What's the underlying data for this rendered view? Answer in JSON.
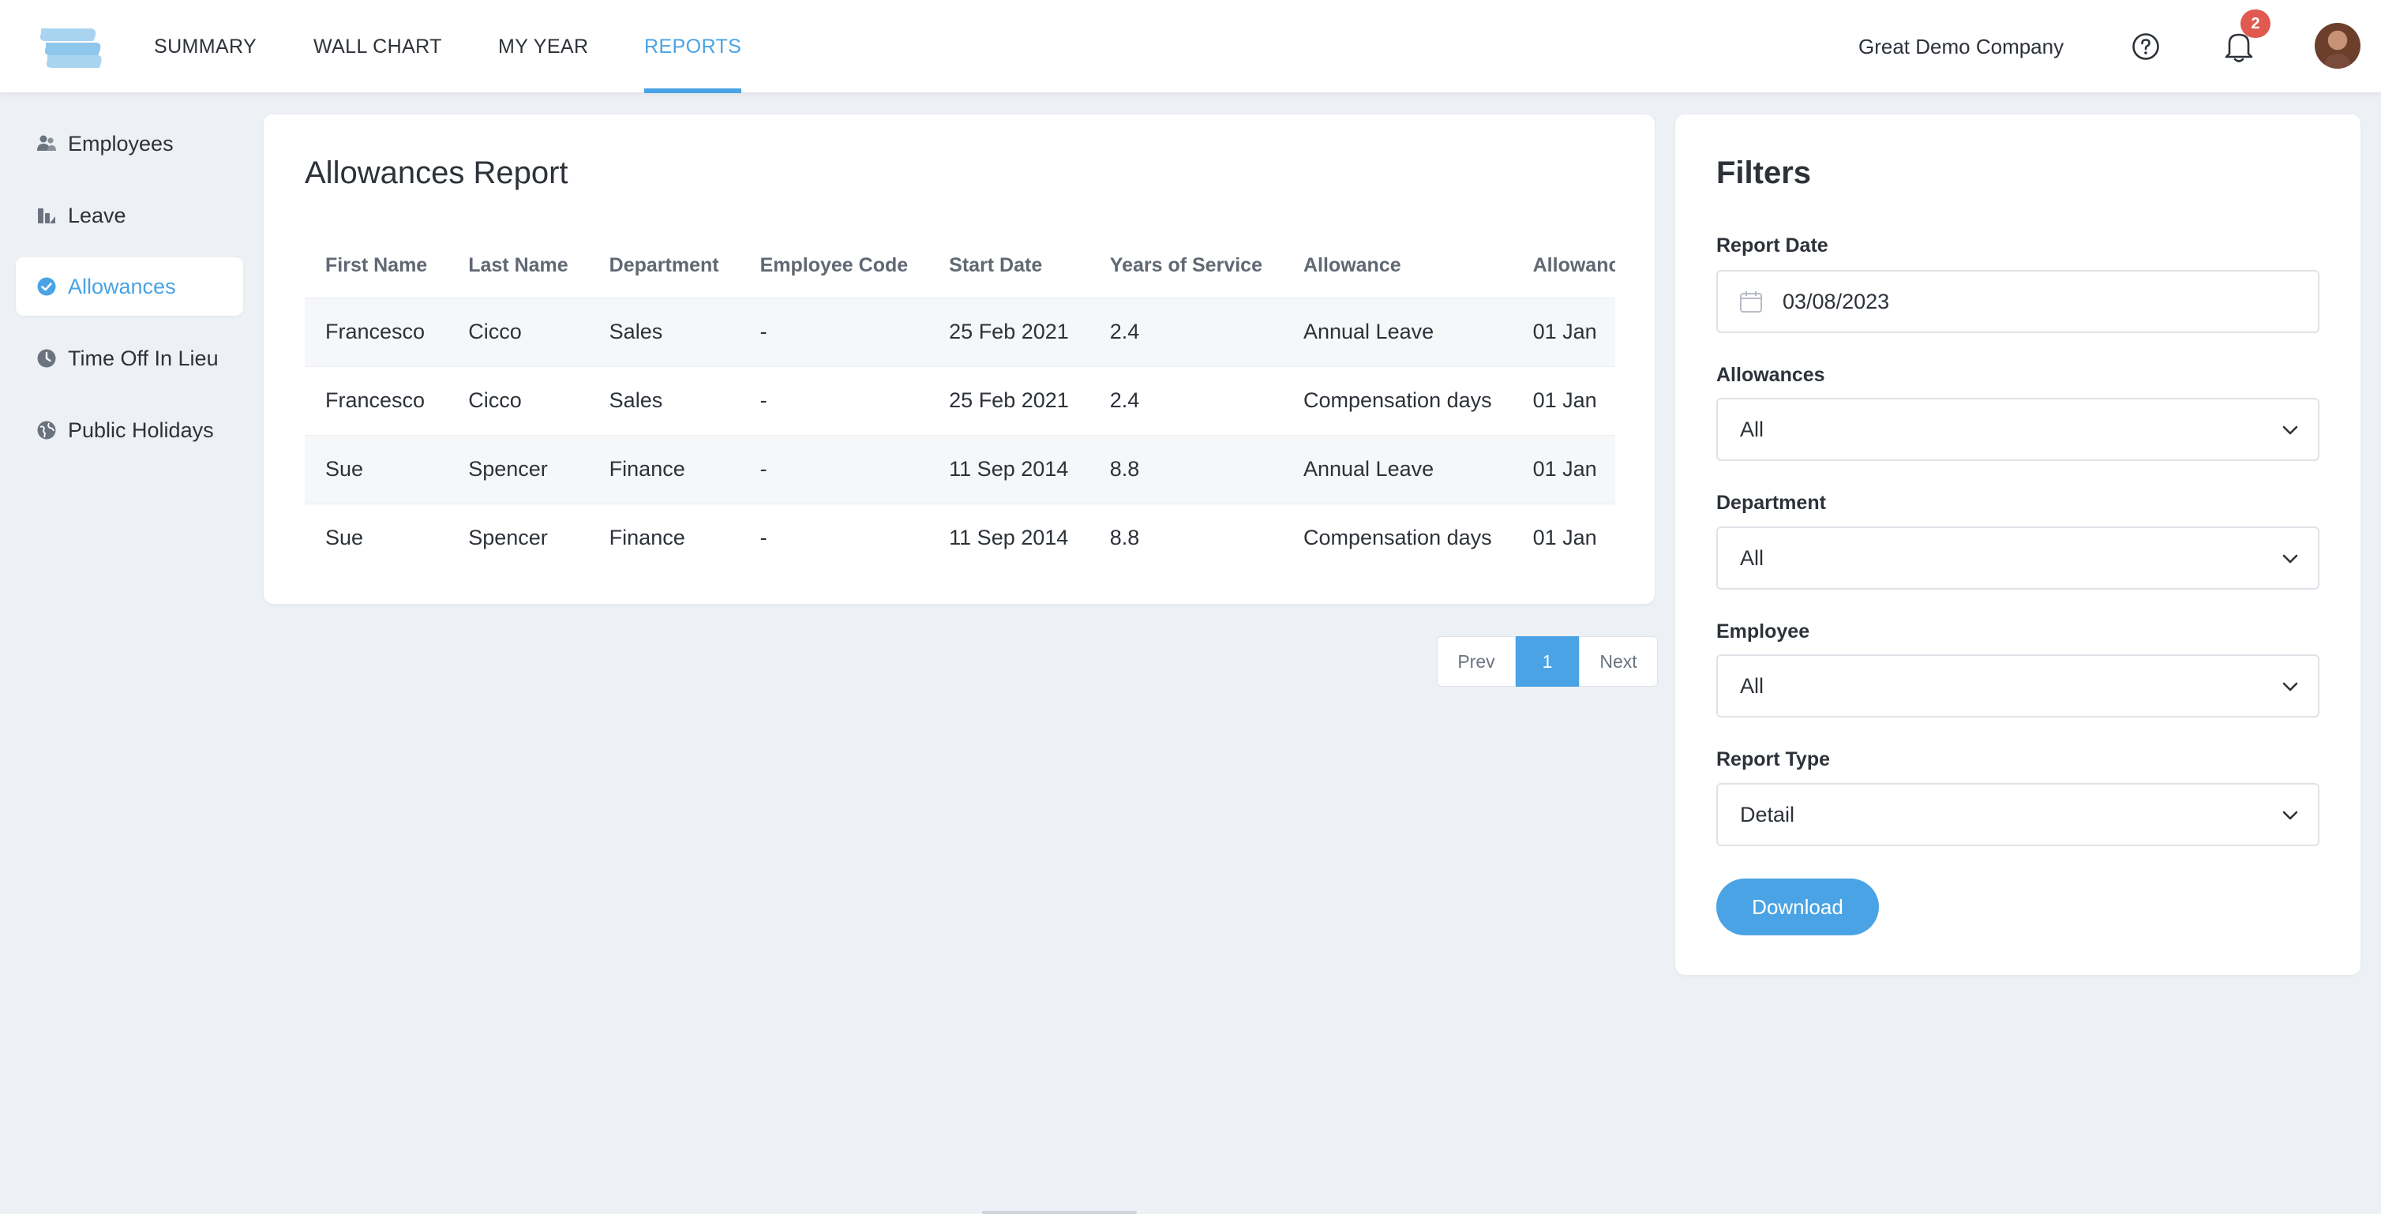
{
  "nav": {
    "items": [
      {
        "label": "SUMMARY"
      },
      {
        "label": "WALL CHART"
      },
      {
        "label": "MY YEAR"
      },
      {
        "label": "REPORTS",
        "active": true
      }
    ],
    "company": "Great Demo Company",
    "notification_count": "2",
    "accent_color": "#4aa3e4"
  },
  "sidebar": {
    "items": [
      {
        "label": "Employees",
        "icon": "users-icon"
      },
      {
        "label": "Leave",
        "icon": "leave-icon"
      },
      {
        "label": "Allowances",
        "icon": "check-circle-icon",
        "active": true
      },
      {
        "label": "Time Off In Lieu",
        "icon": "clock-icon"
      },
      {
        "label": "Public Holidays",
        "icon": "globe-icon"
      }
    ]
  },
  "report": {
    "title": "Allowances Report",
    "columns": [
      "First Name",
      "Last Name",
      "Department",
      "Employee Code",
      "Start Date",
      "Years of Service",
      "Allowance",
      "Allowance"
    ],
    "rows": [
      [
        "Francesco",
        "Cicco",
        "Sales",
        "-",
        "25 Feb 2021",
        "2.4",
        "Annual Leave",
        "01 Jan"
      ],
      [
        "Francesco",
        "Cicco",
        "Sales",
        "-",
        "25 Feb 2021",
        "2.4",
        "Compensation days",
        "01 Jan"
      ],
      [
        "Sue",
        "Spencer",
        "Finance",
        "-",
        "11 Sep 2014",
        "8.8",
        "Annual Leave",
        "01 Jan"
      ],
      [
        "Sue",
        "Spencer",
        "Finance",
        "-",
        "11 Sep 2014",
        "8.8",
        "Compensation days",
        "01 Jan"
      ]
    ]
  },
  "pagination": {
    "prev": "Prev",
    "current": "1",
    "next": "Next"
  },
  "filters": {
    "title": "Filters",
    "report_date": {
      "label": "Report Date",
      "value": "03/08/2023"
    },
    "allowances": {
      "label": "Allowances",
      "value": "All"
    },
    "department": {
      "label": "Department",
      "value": "All"
    },
    "employee": {
      "label": "Employee",
      "value": "All"
    },
    "report_type": {
      "label": "Report Type",
      "value": "Detail"
    },
    "download_label": "Download"
  }
}
